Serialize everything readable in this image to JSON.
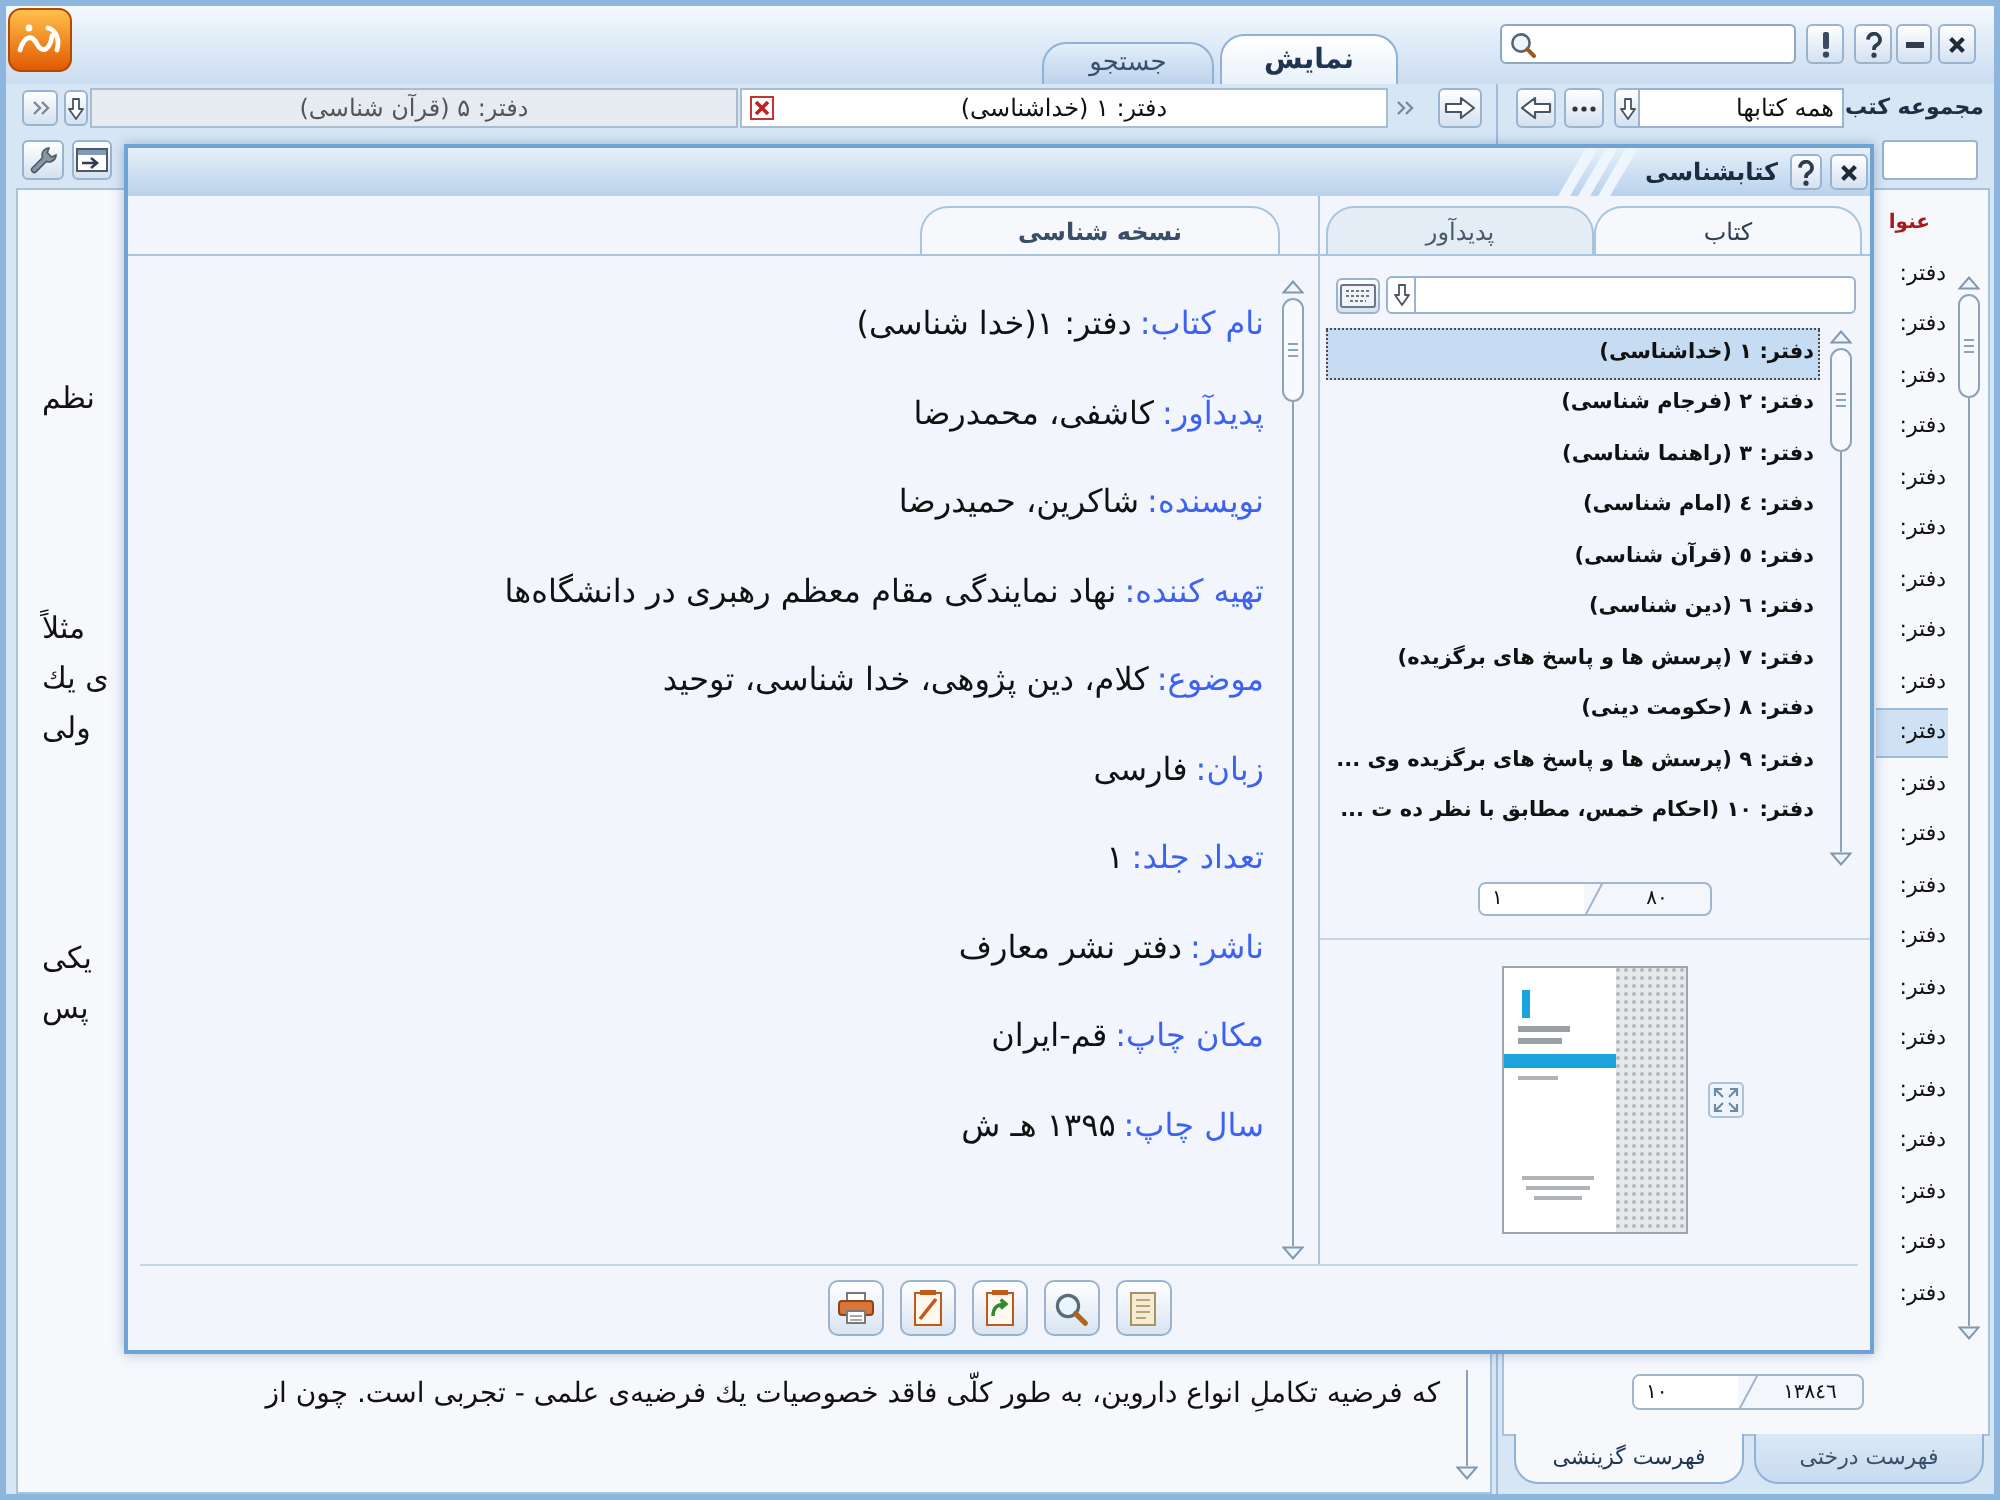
{
  "top_tabs": [
    {
      "label": "نمایش",
      "selected": true
    },
    {
      "label": "جستجو",
      "selected": false
    }
  ],
  "collection": {
    "label": "مجموعه کتب",
    "value": "همه کتابها"
  },
  "document_tabs": [
    {
      "label": "دفتر: ۱ (خداشناسی)",
      "selected": true
    },
    {
      "label": "دفتر: ۵ (قرآن شناسی)",
      "selected": false
    }
  ],
  "document": {
    "fragments": [
      "نظم",
      "مثلاً",
      "ی یك",
      "ولی",
      "یکی",
      "پس"
    ],
    "last_line": "که فرضیه تکاملِ انواع داروین، به طور کلّی فاقد خصوصیات یك فرضیه‌ی علمی - تجربی است. چون از"
  },
  "sidebar": {
    "header": "عنوا",
    "items": [
      {
        "label": "دفتر:",
        "selected": false
      },
      {
        "label": "دفتر:",
        "selected": false
      },
      {
        "label": "دفتر:",
        "selected": false
      },
      {
        "label": "دفتر:",
        "selected": false
      },
      {
        "label": "دفتر:",
        "selected": false
      },
      {
        "label": "دفتر:",
        "selected": false
      },
      {
        "label": "دفتر:",
        "selected": false
      },
      {
        "label": "دفتر:",
        "selected": false
      },
      {
        "label": "دفتر:",
        "selected": false
      },
      {
        "label": "دفتر:",
        "selected": true
      },
      {
        "label": "دفتر:",
        "selected": false
      },
      {
        "label": "دفتر:",
        "selected": false
      },
      {
        "label": "دفتر:",
        "selected": false
      },
      {
        "label": "دفتر:",
        "selected": false
      },
      {
        "label": "دفتر:",
        "selected": false
      },
      {
        "label": "دفتر:",
        "selected": false
      },
      {
        "label": "دفتر:",
        "selected": false
      },
      {
        "label": "دفتر:",
        "selected": false
      },
      {
        "label": "دفتر:",
        "selected": false
      },
      {
        "label": "دفتر:",
        "selected": false
      },
      {
        "label": "دفتر:",
        "selected": false
      }
    ],
    "pager": {
      "count": "۱۳۸٤٦",
      "page": "۱۰"
    },
    "tabs": [
      {
        "label": "فهرست درختی",
        "selected": false
      },
      {
        "label": "فهرست گزینشی",
        "selected": true
      }
    ]
  },
  "dialog": {
    "title": "کتابشناسی",
    "details_tabs": [
      {
        "label": "نسخه شناسی",
        "selected": true
      }
    ],
    "fields": [
      {
        "label": "نام کتاب:",
        "value": "دفتر: ۱(خدا شناسی)"
      },
      {
        "label": "پدیدآور:",
        "value": "کاشفی، محمدرضا"
      },
      {
        "label": "نویسنده:",
        "value": "شاکرین، حمیدرضا"
      },
      {
        "label": "تهیه کننده:",
        "value": "نهاد نمایندگی مقام معظم رهبری در دانشگاه‌ها"
      },
      {
        "label": "موضوع:",
        "value": "کلام، دین پژوهی، خدا شناسی، توحید"
      },
      {
        "label": "زبان:",
        "value": "فارسی"
      },
      {
        "label": "تعداد جلد:",
        "value": "۱"
      },
      {
        "label": "ناشر:",
        "value": "دفتر نشر معارف"
      },
      {
        "label": "مکان چاپ:",
        "value": "قم-ایران"
      },
      {
        "label": "سال چاپ:",
        "value": "۱۳۹۵ هـ ش"
      }
    ],
    "list_tabs": [
      {
        "label": "کتاب",
        "selected": true
      },
      {
        "label": "پدیدآور",
        "selected": false
      }
    ],
    "books": [
      {
        "label": "دفتر: ۱ (خداشناسی)",
        "selected": true
      },
      {
        "label": "دفتر: ۲ (فرجام شناسی)",
        "selected": false
      },
      {
        "label": "دفتر: ۳ (راهنما شناسی)",
        "selected": false
      },
      {
        "label": "دفتر: ٤ (امام شناسی)",
        "selected": false
      },
      {
        "label": "دفتر: ٥ (قرآن شناسی)",
        "selected": false
      },
      {
        "label": "دفتر: ٦ (دین شناسی)",
        "selected": false
      },
      {
        "label": "دفتر: ۷ (پرسش ها و پاسخ های برگزیده)",
        "selected": false
      },
      {
        "label": "دفتر: ۸ (حکومت دینی)",
        "selected": false
      },
      {
        "label": "دفتر: ۹ (پرسش ها و پاسخ های برگزیده وی ...",
        "selected": false
      },
      {
        "label": "دفتر: ۱۰ (احکام خمس، مطابق با نظر ده ت ...",
        "selected": false
      }
    ],
    "pager": {
      "count": "۸۰",
      "page": "۱"
    }
  }
}
